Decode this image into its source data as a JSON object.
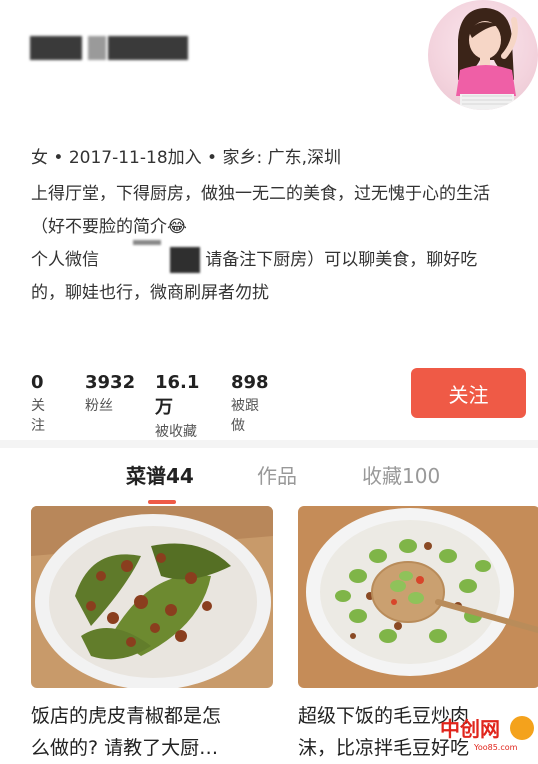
{
  "profile": {
    "meta": "女 • 2017-11-18加入 • 家乡: 广东,深圳",
    "bio_line1": "上得厅堂，下得厨房，做独一无二的美食，过无愧于心的生活",
    "bio_line2": "（好不要脸的简介😂",
    "bio_line3_start": "个人微信",
    "bio_line3_end": "请备注下厨房）可以聊美食，聊好吃",
    "bio_line4": "的，聊娃也行，微商刷屏者勿扰"
  },
  "stats": [
    {
      "num": "0",
      "label": "关注"
    },
    {
      "num": "3932",
      "label": "粉丝"
    },
    {
      "num": "16.1万",
      "label": "被收藏"
    },
    {
      "num": "898",
      "label": "被跟做"
    }
  ],
  "follow_button": "关注",
  "tabs": [
    "菜谱44",
    "作品",
    "收藏100"
  ],
  "cards": [
    {
      "title_line1": "饭店的虎皮青椒都是怎",
      "title_line2": "么做的? 请教了大厨…"
    },
    {
      "title_line1": "超级下饭的毛豆炒肉",
      "title_line2": "沫，比凉拌毛豆好吃"
    }
  ],
  "watermark": {
    "brand": "中创网",
    "url": "Yoo85.com"
  },
  "colors": {
    "accent": "#ef5a46",
    "text": "#222222",
    "muted": "#999999"
  }
}
